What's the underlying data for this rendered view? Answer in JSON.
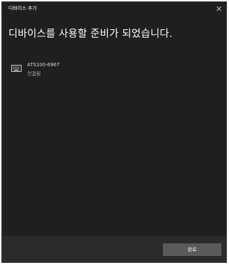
{
  "window": {
    "title": "디바이스 추가"
  },
  "main": {
    "heading": "디바이스를 사용할 준비가 되었습니다."
  },
  "device": {
    "name": "ATS100-6967",
    "status": "연결됨",
    "icon": "keyboard-icon"
  },
  "footer": {
    "done_label": "완료"
  },
  "colors": {
    "background": "#1f1f1f",
    "footer": "#2b2b2b",
    "button": "#5a5a5a",
    "text": "#ffffff"
  }
}
